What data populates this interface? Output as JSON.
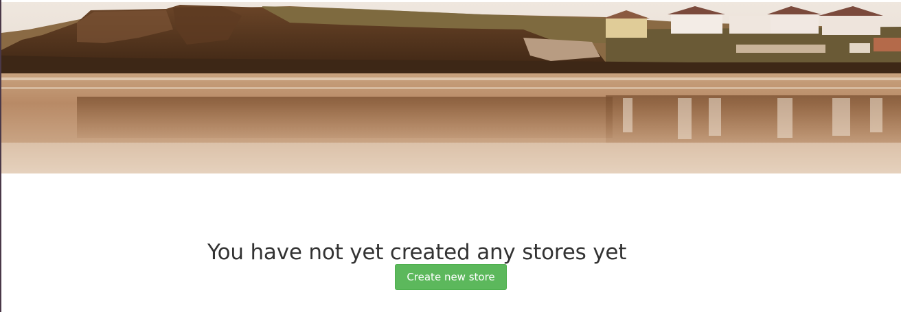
{
  "banner": {
    "image": "sepia-coastal-beach-panorama",
    "sky_color": "#e4d9cd",
    "cliff_color": "#5a3a22",
    "beach_color": "#c59a74",
    "water_color": "#b48462"
  },
  "empty_state": {
    "message": "You have not yet created any stores yet",
    "create_button_label": "Create new store",
    "button_color": "#5cb85c",
    "text_color": "#333333"
  }
}
